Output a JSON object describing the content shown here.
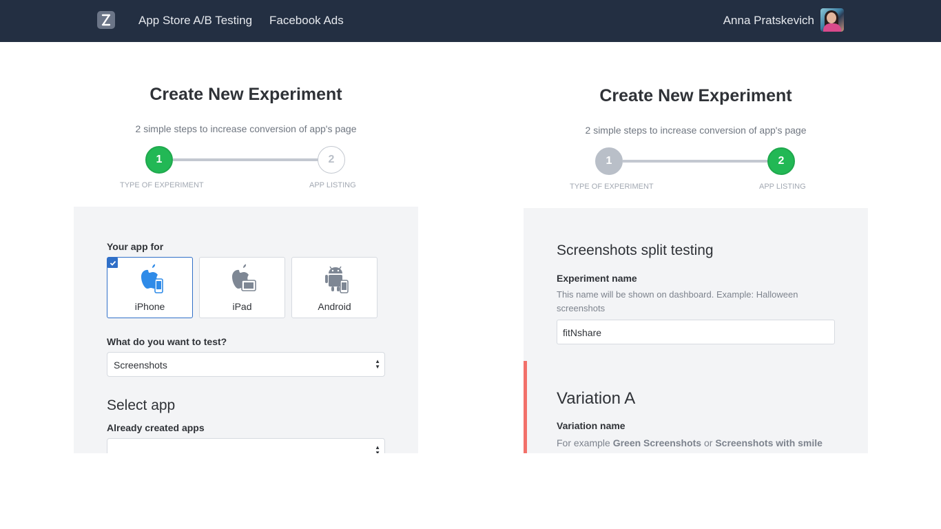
{
  "nav": {
    "logo": "app-logo-icon",
    "links": [
      "App Store A/B Testing",
      "Facebook Ads"
    ],
    "user_name": "Anna Pratskevich"
  },
  "left": {
    "title": "Create New Experiment",
    "subtitle": "2 simple steps to increase conversion of app's page",
    "steps": [
      {
        "number": "1",
        "label": "TYPE OF EXPERIMENT",
        "state": "active"
      },
      {
        "number": "2",
        "label": "APP LISTING",
        "state": "todo"
      }
    ],
    "your_app_for": "Your app for",
    "devices": [
      {
        "name": "iPhone",
        "icon": "apple-iphone-icon",
        "selected": true
      },
      {
        "name": "iPad",
        "icon": "apple-ipad-icon",
        "selected": false
      },
      {
        "name": "Android",
        "icon": "android-icon",
        "selected": false
      }
    ],
    "what_to_test_label": "What do you want to test?",
    "what_to_test_value": "Screenshots",
    "select_app_heading": "Select app",
    "already_created_label": "Already created apps",
    "already_created_value": ""
  },
  "right": {
    "title": "Create New Experiment",
    "subtitle": "2 simple steps to increase conversion of app's page",
    "steps": [
      {
        "number": "1",
        "label": "TYPE OF EXPERIMENT",
        "state": "done"
      },
      {
        "number": "2",
        "label": "APP LISTING",
        "state": "active"
      }
    ],
    "section_heading": "Screenshots split testing",
    "experiment_name_label": "Experiment name",
    "experiment_name_help": "This name will be shown on dashboard. Example: Halloween screenshots",
    "experiment_name_value": "fitNshare",
    "variation_heading": "Variation A",
    "variation_name_label": "Variation name",
    "variation_help_prefix": "For example",
    "variation_help_ex1": "Green Screenshots",
    "variation_help_or": "or",
    "variation_help_ex2": "Screenshots with smile"
  },
  "colors": {
    "topbar": "#232f42",
    "step_active": "#22b855",
    "selected_border": "#2f6fc8",
    "variation_accent": "#f2706a",
    "card_bg": "#f3f4f6"
  }
}
